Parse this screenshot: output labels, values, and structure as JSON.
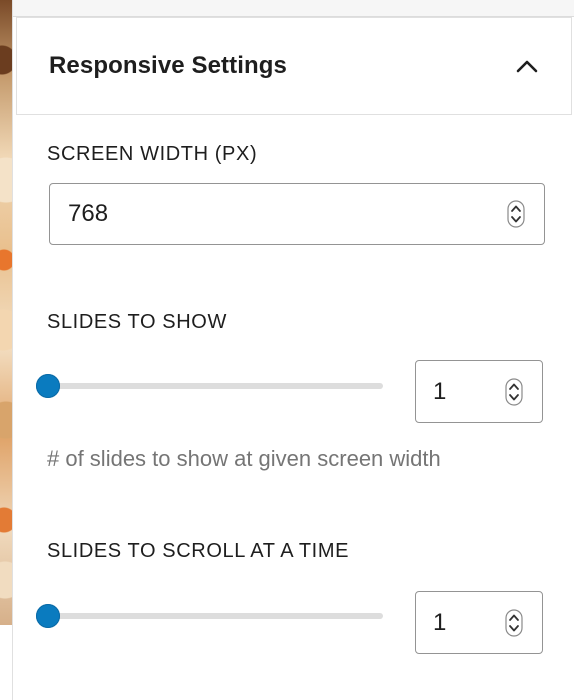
{
  "panel": {
    "title": "Responsive Settings",
    "collapse_icon": "chevron-up-icon"
  },
  "screen_width": {
    "label": "SCREEN WIDTH (PX)",
    "value": "768",
    "stepper_icon": "up-down-arrows-icon"
  },
  "slides_to_show": {
    "label": "SLIDES TO SHOW",
    "value": "1",
    "slider_position": 0,
    "help": "# of slides to show at given screen width"
  },
  "slides_to_scroll": {
    "label": "SLIDES TO SCROLL AT A TIME",
    "value": "1",
    "slider_position": 0
  },
  "colors": {
    "accent": "#0a7bbf",
    "track": "#dddddd",
    "help_text": "#757575"
  }
}
